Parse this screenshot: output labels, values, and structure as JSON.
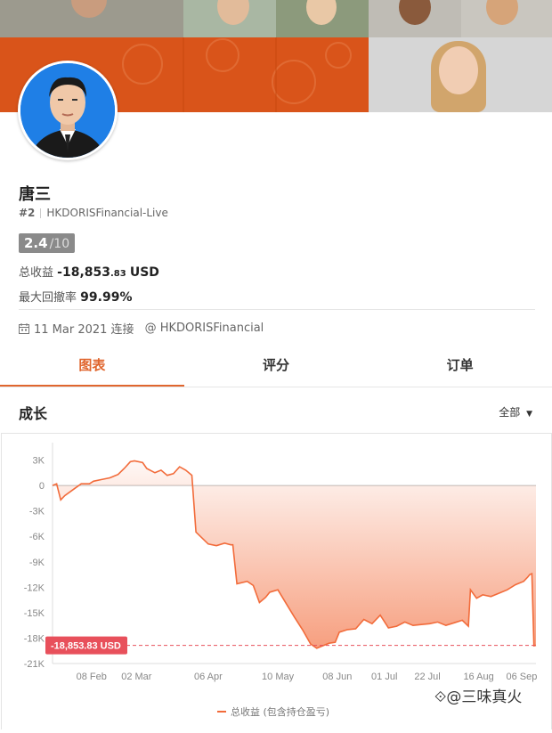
{
  "profile": {
    "name": "唐三",
    "rank": "#2",
    "account": "HKDORISFinancial-Live",
    "score_value": "2.4",
    "score_max": "/10",
    "profit_label": "总收益",
    "profit_main": "-18,853",
    "profit_decimal": ".83",
    "profit_currency": "USD",
    "drawdown_label": "最大回撤率",
    "drawdown_value": "99.99%",
    "connected_date": "11 Mar 2021 连接",
    "broker": "@ HKDORISFinancial"
  },
  "tabs": [
    {
      "label": "图表"
    },
    {
      "label": "评分"
    },
    {
      "label": "订单"
    }
  ],
  "section": {
    "title": "成长",
    "filter_label": "全部"
  },
  "watermark": "⟐@三味真火",
  "colors": {
    "accent": "#e0662e",
    "line": "#f26b3a",
    "loss_tag": "#e8505b"
  },
  "chart_data": {
    "type": "area",
    "current_label": "-18,853.83 USD",
    "current_value": -18853.83,
    "legend": "总收益 (包含持仓盈亏)",
    "ylim": [
      -21000,
      4000
    ],
    "yticks": [
      3000,
      0,
      -3000,
      -6000,
      -9000,
      -12000,
      -15000,
      -18000,
      -21000
    ],
    "ytick_labels": [
      "3K",
      "0",
      "-3K",
      "-6K",
      "-9K",
      "-12K",
      "-15K",
      "-18K",
      "-21K"
    ],
    "xtick_labels": [
      "08 Feb",
      "02 Mar",
      "06 Apr",
      "10 May",
      "08 Jun",
      "01 Jul",
      "22 Jul",
      "16 Aug",
      "06 Sep"
    ],
    "xtick_days": [
      39,
      61,
      96,
      130,
      159,
      182,
      203,
      228,
      249
    ],
    "x_range_days": [
      20,
      256
    ],
    "series": [
      {
        "x": [
          20,
          22,
          24,
          26,
          30,
          34,
          38,
          40,
          44,
          48,
          52,
          55,
          58,
          60,
          64,
          66,
          70,
          73,
          76,
          79,
          82,
          85,
          88,
          90,
          96,
          100,
          104,
          107,
          108,
          110,
          115,
          118,
          121,
          124,
          126,
          130,
          134,
          138,
          142,
          146,
          149,
          152,
          155,
          158,
          160,
          164,
          168,
          172,
          176,
          180,
          184,
          188,
          192,
          196,
          200,
          204,
          208,
          212,
          216,
          220,
          223,
          224,
          227,
          230,
          234,
          238,
          242,
          246,
          250,
          252,
          253,
          254,
          255,
          256
        ],
        "y": [
          0,
          200,
          -1700,
          -1200,
          -500,
          200,
          200,
          500,
          700,
          900,
          1300,
          2000,
          2800,
          2900,
          2700,
          2000,
          1500,
          1800,
          1200,
          1400,
          2200,
          1800,
          1200,
          -5500,
          -6900,
          -7100,
          -6800,
          -7000,
          -7000,
          -11600,
          -11300,
          -11800,
          -13800,
          -13200,
          -12600,
          -12300,
          -13900,
          -15500,
          -17000,
          -18700,
          -19200,
          -18900,
          -18600,
          -18500,
          -17300,
          -17000,
          -16900,
          -15800,
          -16300,
          -15300,
          -16800,
          -16600,
          -16100,
          -16500,
          -16400,
          -16300,
          -16100,
          -16500,
          -16200,
          -15900,
          -16600,
          -12300,
          -13300,
          -12900,
          -13100,
          -12700,
          -12300,
          -11700,
          -11300,
          -10800,
          -10500,
          -10400,
          -18900,
          -18853.83
        ]
      }
    ]
  }
}
